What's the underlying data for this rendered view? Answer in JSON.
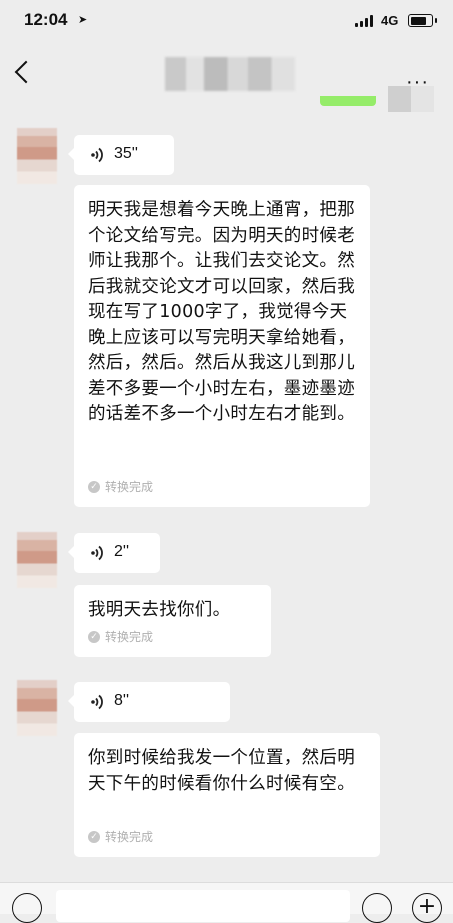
{
  "status_bar": {
    "time": "12:04",
    "network": "4G",
    "battery_level": 0.75
  },
  "nav": {
    "more_label": "···"
  },
  "messages": [
    {
      "duration": "35''",
      "text": "明天我是想着今天晚上通宵，把那个论文给写完。因为明天的时候老师让我那个。让我们去交论文。然后我就交论文才可以回家，然后我现在写了1000字了，我觉得今天晚上应该可以写完明天拿给她看，然后，然后。然后从我这儿到那儿差不多要一个小时左右，墨迹墨迹的话差不多一个小时左右才能到。",
      "status": "转换完成"
    },
    {
      "duration": "2''",
      "text": "我明天去找你们。",
      "status": "转换完成"
    },
    {
      "duration": "8''",
      "text": "你到时候给我发一个位置，然后明天下午的时候看你什么时候有空。",
      "status": "转换完成"
    }
  ],
  "icons": {
    "voice": "voice-wave-icon",
    "check": "check-circle-icon",
    "back": "chevron-left-icon",
    "emoji": "emoji-icon",
    "plus": "plus-circle-icon"
  },
  "colors": {
    "background": "#ededed",
    "bubble": "#ffffff",
    "sent_bubble": "#95ec69",
    "status_text": "#b0b0b0"
  }
}
